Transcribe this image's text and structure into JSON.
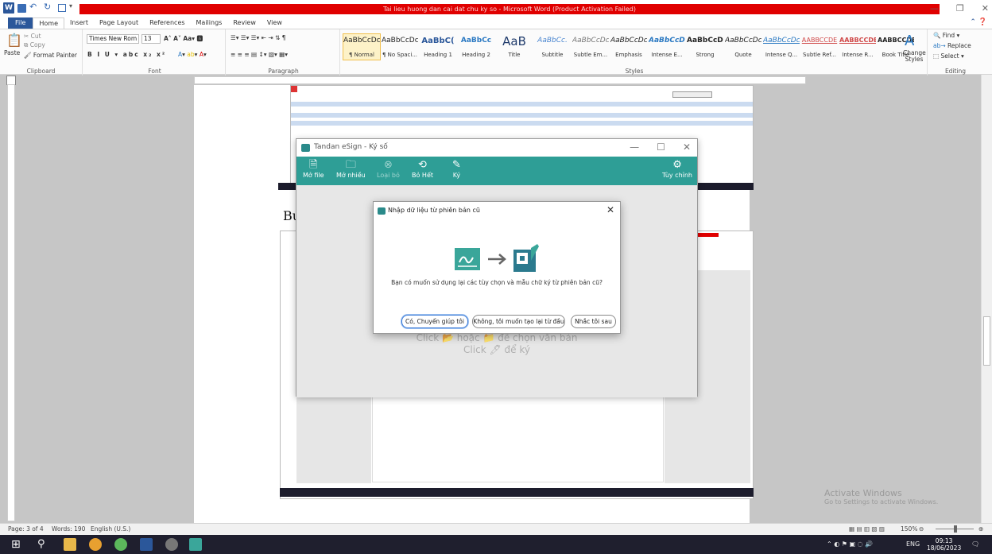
{
  "window": {
    "title": "Tai lieu huong dan cai dat chu ky so - Microsoft Word (Product Activation Failed)"
  },
  "tabs": [
    "File",
    "Home",
    "Insert",
    "Page Layout",
    "References",
    "Mailings",
    "Review",
    "View"
  ],
  "ribbon": {
    "clipboard": {
      "label": "Clipboard",
      "paste": "Paste",
      "cut": "Cut",
      "copy": "Copy",
      "format_painter": "Format Painter"
    },
    "font": {
      "label": "Font",
      "name": "Times New Rom",
      "size": "13"
    },
    "paragraph": {
      "label": "Paragraph"
    },
    "styles": {
      "label": "Styles",
      "items": [
        {
          "preview": "AaBbCcDc",
          "name": "¶ Normal"
        },
        {
          "preview": "AaBbCcDc",
          "name": "¶ No Spaci..."
        },
        {
          "preview": "AaBbC(",
          "name": "Heading 1"
        },
        {
          "preview": "AaBbCc",
          "name": "Heading 2"
        },
        {
          "preview": "AaB",
          "name": "Title"
        },
        {
          "preview": "AaBbCc.",
          "name": "Subtitle"
        },
        {
          "preview": "AaBbCcDc",
          "name": "Subtle Em..."
        },
        {
          "preview": "AaBbCcDc",
          "name": "Emphasis"
        },
        {
          "preview": "AaBbCcDc",
          "name": "Intense E..."
        },
        {
          "preview": "AaBbCcDc",
          "name": "Strong"
        },
        {
          "preview": "AaBbCcDc",
          "name": "Quote"
        },
        {
          "preview": "AaBbCcDc",
          "name": "Intense Q..."
        },
        {
          "preview": "AABBCCDE",
          "name": "Subtle Ref..."
        },
        {
          "preview": "AABBCCDE",
          "name": "Intense R..."
        },
        {
          "preview": "AABBCCDE",
          "name": "Book Title"
        }
      ],
      "change_styles": "Change Styles"
    },
    "editing": {
      "label": "Editing",
      "find": "Find",
      "replace": "Replace",
      "select": "Select"
    }
  },
  "document": {
    "visible_word": "Bu"
  },
  "esign": {
    "title": "Tandan eSign - Ký số",
    "tools": [
      {
        "label": "Mở file",
        "icon": "open-file-icon"
      },
      {
        "label": "Mở nhiều",
        "icon": "open-multiple-icon"
      },
      {
        "label": "Loại bỏ",
        "icon": "remove-icon"
      },
      {
        "label": "Bỏ Hết",
        "icon": "clear-all-icon"
      },
      {
        "label": "Ký",
        "icon": "sign-pen-icon"
      }
    ],
    "settings_label": "Tùy chỉnh",
    "hint_line1": "Click 📂 hoặc 📁 để chọn văn bản",
    "hint_line2": "Click 🖊 để ký"
  },
  "dialog": {
    "title": "Nhập dữ liệu từ phiên bản cũ",
    "message": "Bạn có muốn sử dụng lại các tùy chọn và mẫu chữ ký từ phiên bản cũ?",
    "buttons": {
      "yes": "Có, Chuyển giúp tôi",
      "no": "Không, tôi muốn tạo lại từ đầu",
      "later": "Nhắc tôi sau"
    }
  },
  "statusbar": {
    "page": "Page: 3 of 4",
    "words": "Words: 190",
    "language": "English (U.S.)",
    "zoom": "150%"
  },
  "watermark": {
    "line1": "Activate Windows",
    "line2": "Go to Settings to activate Windows."
  },
  "taskbar": {
    "language": "ENG",
    "time": "09:13",
    "date": "18/06/2023"
  },
  "colors": {
    "word_blue": "#2b579a",
    "title_red": "#e00000",
    "esign_teal": "#2e9e96"
  }
}
